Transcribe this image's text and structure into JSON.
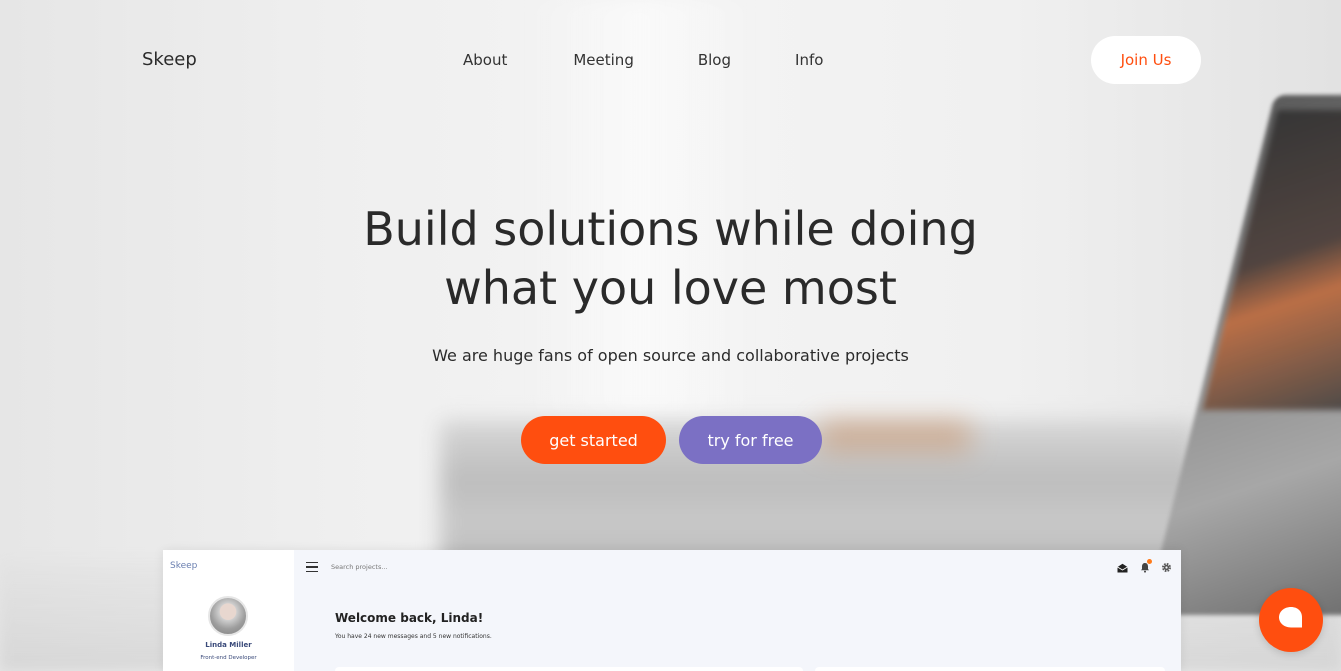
{
  "nav": {
    "logo": "Skeep",
    "items": [
      {
        "label": "About"
      },
      {
        "label": "Meeting"
      },
      {
        "label": "Blog"
      },
      {
        "label": "Info"
      }
    ],
    "join_label": "Join Us"
  },
  "hero": {
    "title_line1": "Build solutions while doing",
    "title_line2": "what you love most",
    "subtitle": "We are huge fans of open source and collaborative projects",
    "primary_button": "get started",
    "secondary_button": "try for free"
  },
  "dashboard": {
    "logo": "Skeep",
    "user_name": "Linda Miller",
    "user_role": "Front-end Developer",
    "search_placeholder": "Search projects...",
    "welcome": "Welcome back, Linda!",
    "message": "You have 24 new messages and 5 new notifications."
  },
  "colors": {
    "accent": "#ff4e0f",
    "secondary": "#7b70c4"
  },
  "icons": {
    "dash_menu": "hamburger-icon",
    "dash_mail": "mail-icon",
    "dash_bell": "bell-icon",
    "dash_settings": "gear-icon",
    "chat": "chat-bubble-icon"
  }
}
